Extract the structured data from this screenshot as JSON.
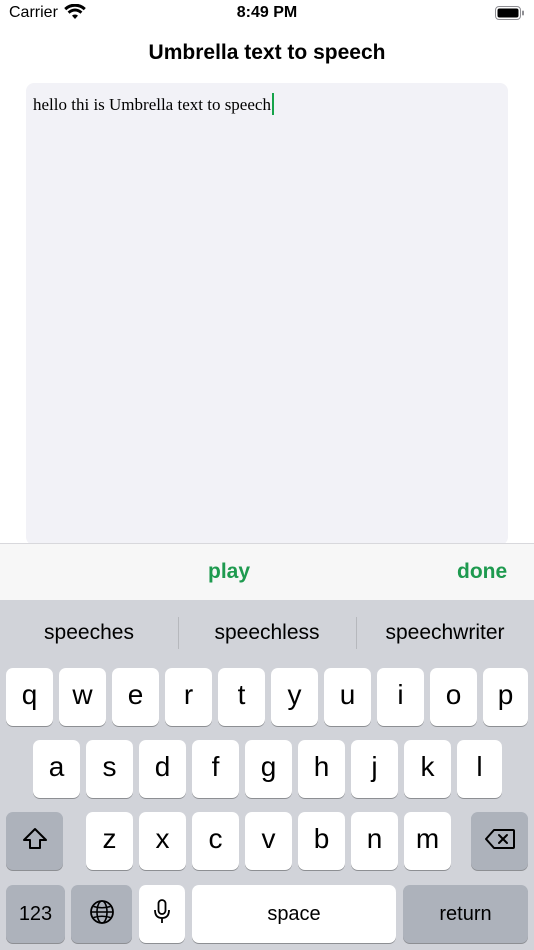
{
  "status_bar": {
    "carrier": "Carrier",
    "time": "8:49 PM",
    "wifi_icon": "wifi-icon",
    "battery_icon": "battery-icon"
  },
  "header": {
    "title": "Umbrella text to speech"
  },
  "editor": {
    "text": "hello thi is Umbrella text to speech",
    "caret_color": "#16a34a",
    "background": "#f2f2f7"
  },
  "toolbar": {
    "play_label": "play",
    "done_label": "done",
    "accent_color": "#1e9a4f"
  },
  "keyboard": {
    "suggestions": [
      "speeches",
      "speechless",
      "speechwriter"
    ],
    "row1": [
      "q",
      "w",
      "e",
      "r",
      "t",
      "y",
      "u",
      "i",
      "o",
      "p"
    ],
    "row2": [
      "a",
      "s",
      "d",
      "f",
      "g",
      "h",
      "j",
      "k",
      "l"
    ],
    "row3": [
      "z",
      "x",
      "c",
      "v",
      "b",
      "n",
      "m"
    ],
    "numbers_label": "123",
    "space_label": "space",
    "return_label": "return",
    "shift_icon": "shift-icon",
    "backspace_icon": "backspace-icon",
    "globe_icon": "globe-icon",
    "mic_icon": "microphone-icon"
  }
}
